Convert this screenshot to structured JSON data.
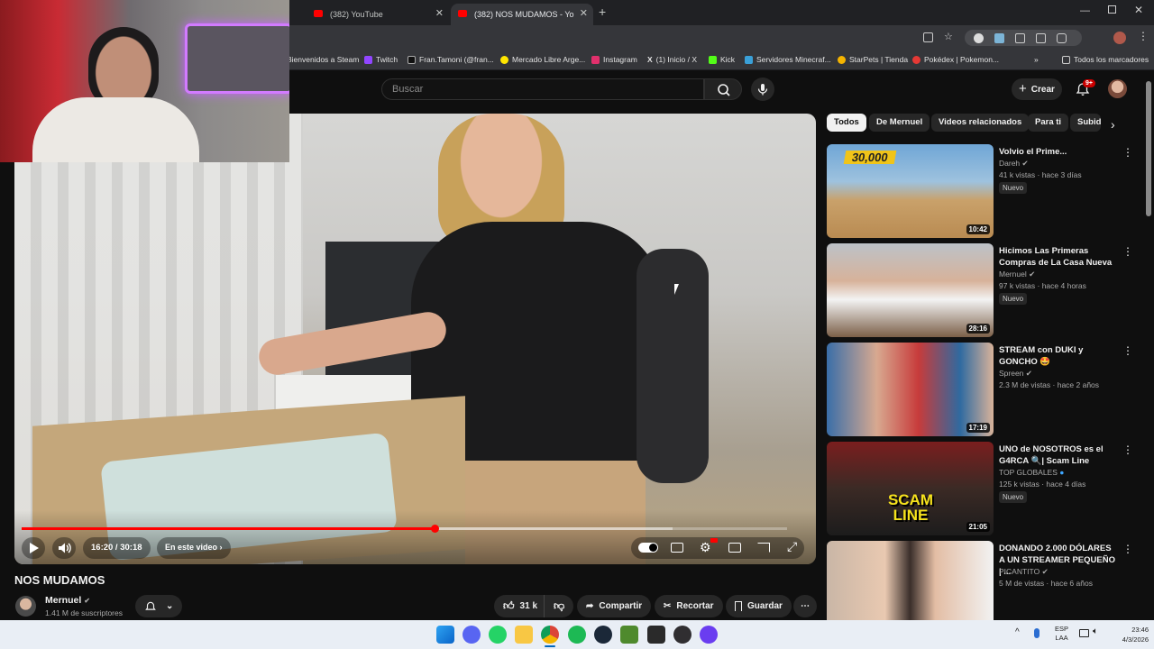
{
  "browser": {
    "tabs": [
      {
        "label": "(382) YouTube"
      },
      {
        "label": "(382) NOS MUDAMOS - Yo"
      }
    ],
    "bookmarks": [
      "Bienvenidos a Steam",
      "Twitch",
      "Fran.Tamoni (@fran...",
      "Mercado Libre Arge...",
      "Instagram",
      "(1) Inicio / X",
      "Kick",
      "Servidores Minecraf...",
      "StarPets | Tienda",
      "Pokédex | Pokemon...",
      "Todos los marcadores"
    ]
  },
  "youtube": {
    "search_placeholder": "Buscar",
    "create_label": "Crear",
    "notification_count": "9+",
    "chips": [
      "Todos",
      "De Mernuel",
      "Videos relacionados",
      "Para ti",
      "Subid"
    ],
    "player": {
      "time": "16:20 / 30:18",
      "chapter_label": "En este video",
      "progress_fraction": 0.54,
      "buffer_fraction": 0.85
    },
    "video_title": "NOS MUDAMOS",
    "channel_name": "Mernuel",
    "subscribers": "1.41 M de suscriptores",
    "actions": {
      "likes": "31 k",
      "share": "Compartir",
      "clip": "Recortar",
      "save": "Guardar"
    },
    "recommendations": [
      {
        "title": "Volvio el Prime...",
        "channel": "Dareh",
        "meta": "41 k vistas · hace 3 días",
        "badge": "Nuevo",
        "duration": "10:42",
        "overlay": "30,000"
      },
      {
        "title": "Hicimos Las Primeras Compras de La Casa Nueva",
        "channel": "Mernuel",
        "meta": "97 k vistas · hace 4 horas",
        "badge": "Nuevo",
        "duration": "28:16"
      },
      {
        "title": "STREAM con DUKI y GONCHO 🤩",
        "channel": "Spreen",
        "meta": "2.3 M de vistas · hace 2 años",
        "badge": "",
        "duration": "17:19"
      },
      {
        "title": "UNO de NOSOTROS es el G4RCA 🔍| Scam Line",
        "channel": "TOP GLOBALES",
        "meta": "125 k vistas · hace 4 días",
        "badge": "Nuevo",
        "duration": "21:05",
        "overlay": "SCAM LINE"
      },
      {
        "title": "DONANDO 2.000 DÓLARES A UN STREAMER PEQUEÑO | ...",
        "channel": "PICANTITO",
        "meta": "5 M de vistas · hace 6 años",
        "badge": "",
        "duration": ""
      }
    ]
  },
  "taskbar": {
    "lang_top": "ESP",
    "lang_bottom": "LAA",
    "time": "23:46",
    "date": "4/3/2026"
  },
  "colors": {
    "yt_red": "#ff0000",
    "bg": "#0f0f0f",
    "chip_bg": "#272727"
  }
}
